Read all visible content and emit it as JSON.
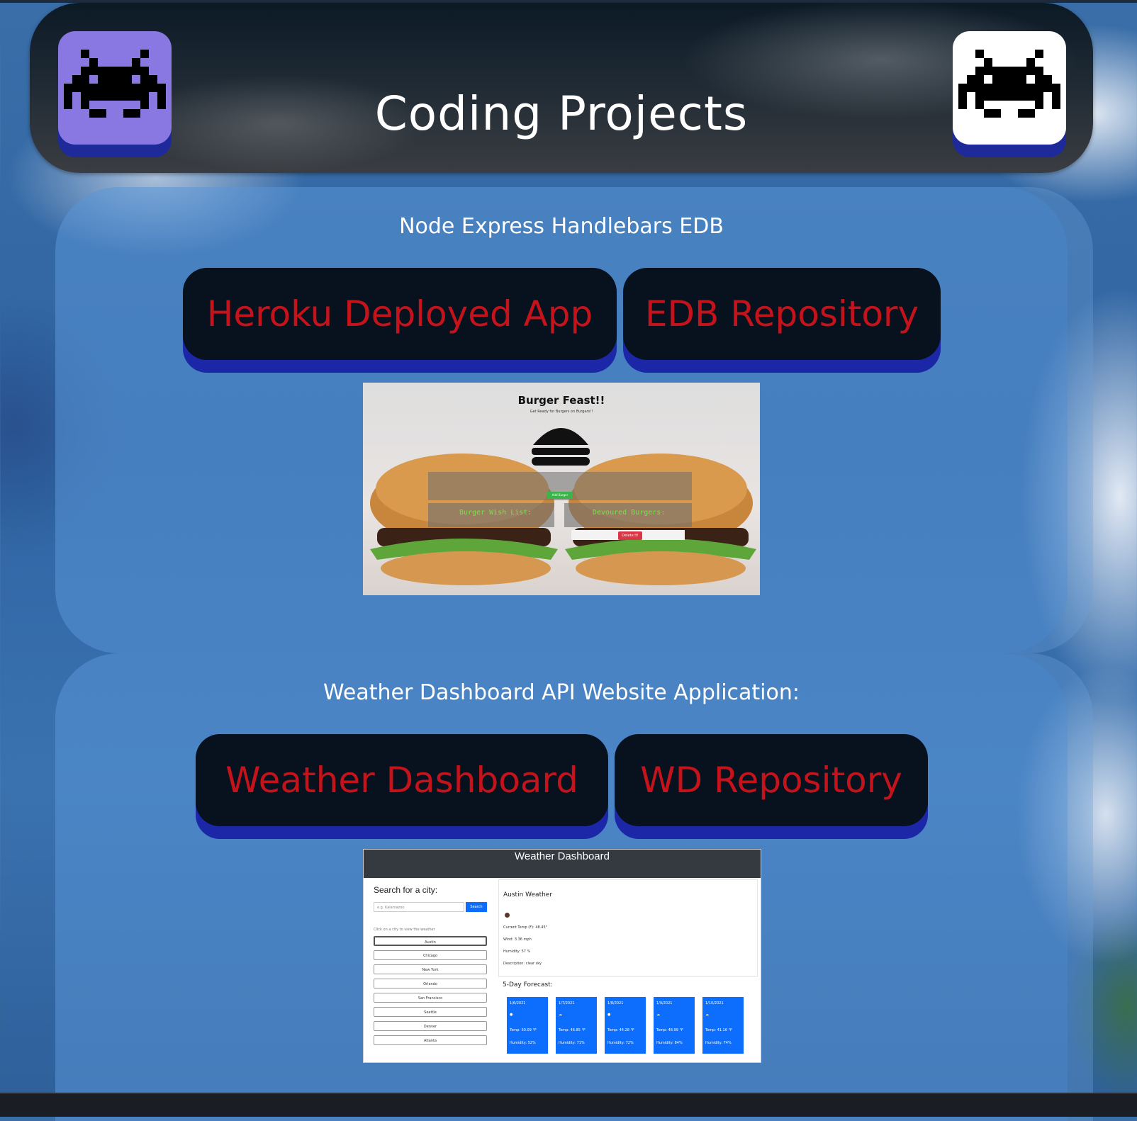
{
  "header": {
    "title": "Coding Projects"
  },
  "sections": [
    {
      "title": "Node Express Handlebars EDB",
      "buttons": [
        "Heroku Deployed App",
        "EDB Repository"
      ],
      "screenshot": {
        "title": "Burger Feast!!",
        "subtitle": "Get Ready for Burgers on Burgers!!",
        "wish_list": "Burger Wish List:",
        "devoured": "Devoured Burgers:",
        "add_button": "Add Burger",
        "delete_button": "Delete It!"
      }
    },
    {
      "title": "Weather Dashboard API Website Application:",
      "buttons": [
        "Weather Dashboard",
        "WD Repository"
      ],
      "screenshot": {
        "title": "Weather Dashboard",
        "search_label": "Search for a city:",
        "search_placeholder": "e.g. Kalamazoo",
        "search_button": "Search",
        "hint": "Click on a city to view the weather",
        "cities": [
          "Austin",
          "Chicago",
          "New York",
          "Orlando",
          "San Francisco",
          "Seattle",
          "Denver",
          "Atlanta"
        ],
        "current_title": "Austin Weather",
        "stats": [
          "Current Temp (F): 48.45°",
          "Wind: 3.36 mph",
          "Humidity: 57 %",
          "Description: clear sky"
        ],
        "forecast_label": "5-Day Forecast:",
        "forecast": [
          {
            "date": "1/6/2021",
            "temp": "Temp: 50.09 °F",
            "humidity": "Humidity: 52%"
          },
          {
            "date": "1/7/2021",
            "temp": "Temp: 46.85 °F",
            "humidity": "Humidity: 71%"
          },
          {
            "date": "1/8/2021",
            "temp": "Temp: 44.28 °F",
            "humidity": "Humidity: 72%"
          },
          {
            "date": "1/9/2021",
            "temp": "Temp: 48.99 °F",
            "humidity": "Humidity: 84%"
          },
          {
            "date": "1/10/2021",
            "temp": "Temp: 41.16 °F",
            "humidity": "Humidity: 74%"
          }
        ]
      }
    }
  ],
  "icons": {
    "header_left": "space-invader-icon",
    "header_right": "space-invader-icon"
  },
  "colors": {
    "button_text": "#c4131b",
    "button_bg": "#08111e",
    "button_shadow": "#1b27a6",
    "tile_left": "#8a78e2"
  }
}
